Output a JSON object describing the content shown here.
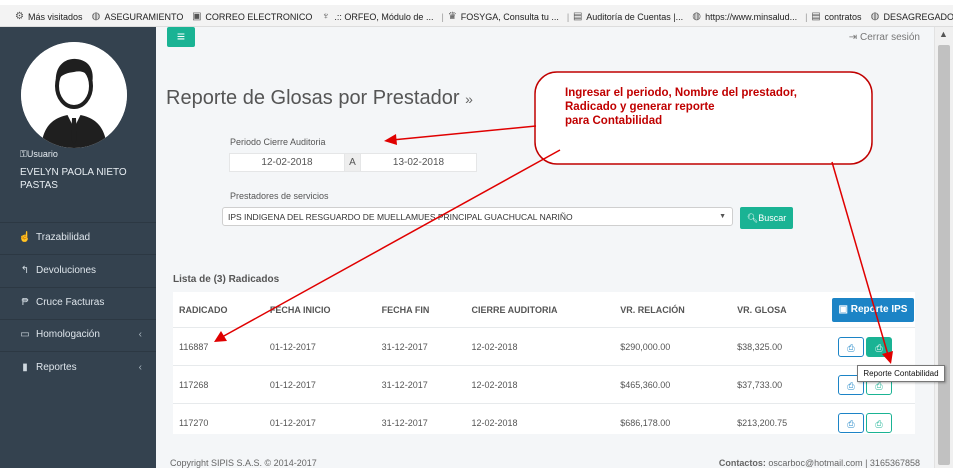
{
  "bookmarks": [
    {
      "icon": "gear-icon",
      "label": "Más visitados"
    },
    {
      "icon": "globe-icon",
      "label": "ASEGURAMIENTO"
    },
    {
      "icon": "mail-icon",
      "label": "CORREO ELECTRONICO"
    },
    {
      "icon": "orfeo-icon",
      "label": ".:: ORFEO, Módulo de ..."
    },
    {
      "icon": "fosyga-icon",
      "label": "FOSYGA, Consulta tu ..."
    },
    {
      "icon": "page-icon",
      "label": "Auditoría de Cuentas |..."
    },
    {
      "icon": "globe-icon",
      "label": "https://www.minsalud..."
    },
    {
      "icon": "page-icon",
      "label": "contratos"
    },
    {
      "icon": "globe-icon",
      "label": "DESAGREGADOR"
    }
  ],
  "sidebar": {
    "user_label": "Usuario",
    "user_name": "EVELYN PAOLA NIETO PASTAS",
    "items": [
      {
        "label": "Trazabilidad",
        "icon": "thumbs-up-icon"
      },
      {
        "label": "Devoluciones",
        "icon": "reply-icon"
      },
      {
        "label": "Cruce Facturas",
        "icon": "paragraph-icon"
      },
      {
        "label": "Homologación",
        "icon": "monitor-icon"
      },
      {
        "label": "Reportes",
        "icon": "book-icon"
      }
    ]
  },
  "header": {
    "menu_icon": "≡",
    "logout": "Cerrar sesión"
  },
  "page": {
    "title": "Reporte de Glosas por Prestador",
    "title_suffix": "»"
  },
  "form": {
    "period_label": "Periodo Cierre Auditoria",
    "date_from": "12-02-2018",
    "date_sep": "A",
    "date_to": "13-02-2018",
    "providers_label": "Prestadores de servicios",
    "provider_selected": "IPS INDIGENA DEL RESGUARDO DE MUELLAMUES PRINCIPAL GUACHUCAL NARIÑO",
    "search_button": "Buscar"
  },
  "list": {
    "title": "Lista de (3) Radicados",
    "report_ips_button": "Reporte IPS",
    "columns": [
      "RADICADO",
      "FECHA INICIO",
      "FECHA FIN",
      "CIERRE AUDITORIA",
      "VR. RELACIÓN",
      "VR. GLOSA"
    ],
    "rows": [
      [
        "116887",
        "01-12-2017",
        "31-12-2017",
        "12-02-2018",
        "$290,000.00",
        "$38,325.00"
      ],
      [
        "117268",
        "01-12-2017",
        "31-12-2017",
        "12-02-2018",
        "$465,360.00",
        "$37,733.00"
      ],
      [
        "117270",
        "01-12-2017",
        "31-12-2017",
        "12-02-2018",
        "$686,178.00",
        "$213,200.75"
      ]
    ]
  },
  "footer": {
    "copyright": "Copyright SIPIS S.A.S. © 2014-2017",
    "contact_label": "Contactos:",
    "contact_value": "oscarboc@hotmail.com | 3165367858"
  },
  "annotation": {
    "line1": "Ingresar el periodo, Nombre del prestador,",
    "line2": "Radicado y generar reporte",
    "line3": "para Contabilidad",
    "color": "#c00000"
  },
  "tooltip": "Reporte Contabilidad",
  "colors": {
    "sidebar": "#34424f",
    "accent_green": "#1ab394",
    "accent_blue": "#1c84c6"
  }
}
